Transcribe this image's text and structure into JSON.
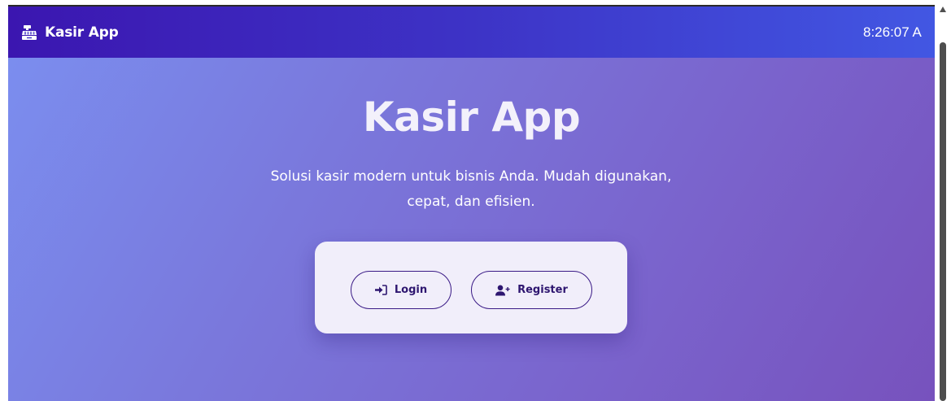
{
  "navbar": {
    "brand_icon": "cash-register-icon",
    "brand_text": "Kasir App",
    "clock": "8:26:07 A"
  },
  "hero": {
    "title": "Kasir App",
    "subtitle": "Solusi kasir modern untuk bisnis Anda. Mudah digunakan, cepat, dan efisien."
  },
  "actions": {
    "login_icon": "sign-in-icon",
    "login_label": "Login",
    "register_icon": "user-plus-icon",
    "register_label": "Register"
  },
  "colors": {
    "navbar_start": "#3b16b0",
    "navbar_end": "#4257e3",
    "background_start": "#7b8ff0",
    "background_end": "#7752bd",
    "card": "#f1eefa",
    "button_accent": "#3a1a86"
  }
}
